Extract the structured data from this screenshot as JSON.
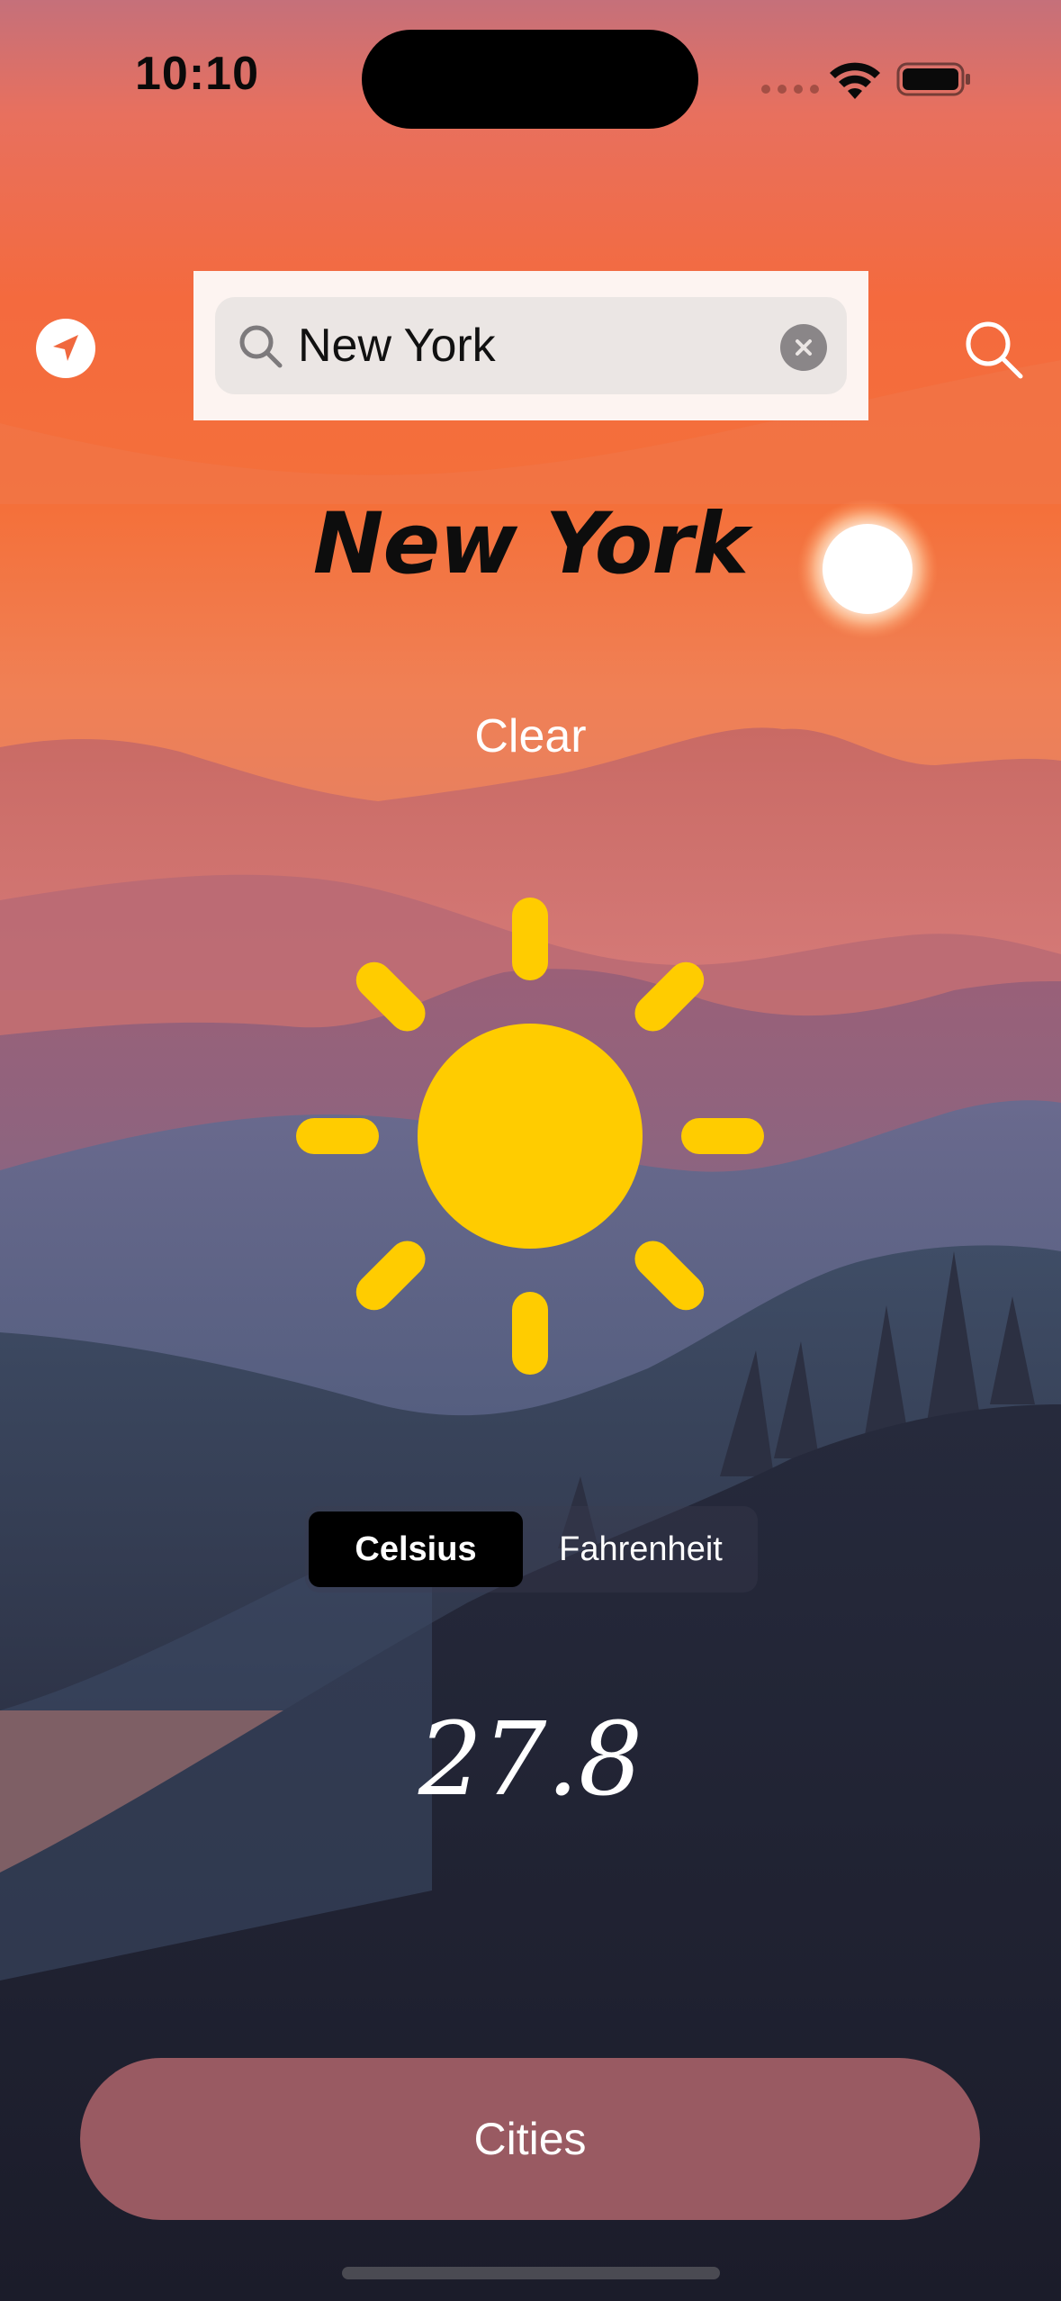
{
  "status_bar": {
    "time": "10:10"
  },
  "search": {
    "value": "New York",
    "placeholder": "",
    "icon": "magnifying-glass-icon",
    "clear_icon": "clear-x-icon"
  },
  "top_bar": {
    "location_icon": "location-arrow-icon",
    "search_icon": "magnifying-glass-icon"
  },
  "weather": {
    "city": "New York",
    "condition": "Clear",
    "condition_icon": "sun-icon",
    "temperature": "27.8"
  },
  "units": {
    "options": [
      "Celsius",
      "Fahrenheit"
    ],
    "selected": "Celsius"
  },
  "cities_button": {
    "label": "Cities"
  },
  "colors": {
    "sky_top": "#f0685a",
    "sky_mid": "#f56a3c",
    "sun": "#ffcc00",
    "cities_button": "#995a62",
    "segment_selected": "#000000",
    "search_frame": "#fdf4f1",
    "search_field": "#ebe6e4"
  }
}
